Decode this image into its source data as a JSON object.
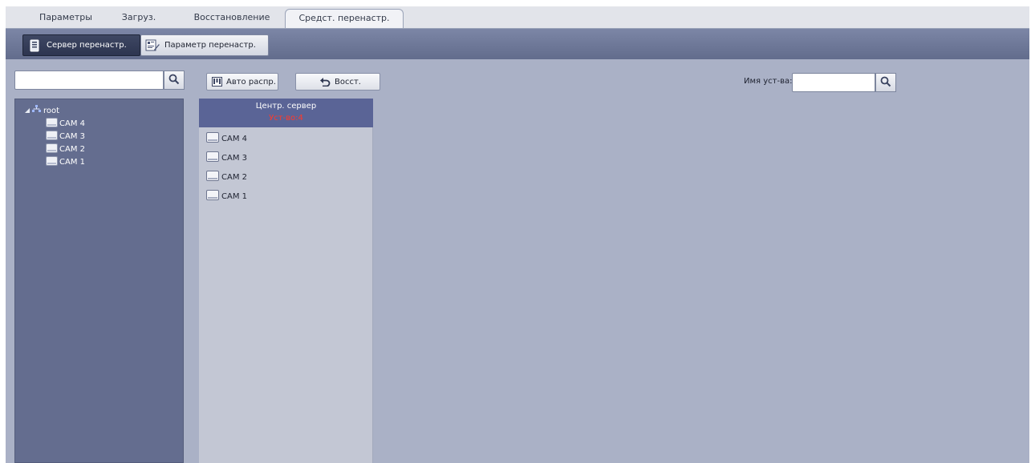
{
  "tabs": [
    {
      "label": "Параметры"
    },
    {
      "label": "Загруз."
    },
    {
      "label": "Восстановление"
    },
    {
      "label": "Средст. перенастр."
    }
  ],
  "active_tab": "Средст. перенастр.",
  "subtoolbar": {
    "server_label": "Сервер перенастр.",
    "params_label": "Параметр перенастр."
  },
  "left": {
    "search_value": "",
    "tree": {
      "root": "root",
      "items": [
        "CAM 4",
        "CAM 3",
        "CAM 2",
        "CAM 1"
      ]
    }
  },
  "toolbar": {
    "auto_label": "Авто распр.",
    "restore_label": "Восст."
  },
  "middle": {
    "header_title": "Центр. сервер",
    "header_sub": "Уст-во:4",
    "items": [
      "CAM 4",
      "CAM 3",
      "CAM 2",
      "CAM 1"
    ]
  },
  "device_search": {
    "label": "Имя уст-ва:",
    "value": ""
  },
  "colors": {
    "workspace": "#aab1c6",
    "left_panel": "#646d8f",
    "middle_panel": "#c3c7d4",
    "header": "#5a6496",
    "count_text": "#ff3a2a"
  },
  "icons": {
    "search": "search-icon",
    "server": "server-icon",
    "params": "edit-params-icon",
    "auto": "auto-distribute-icon",
    "restore": "undo-icon",
    "tree_root": "network-tree-icon",
    "camera": "camera-device-icon"
  }
}
